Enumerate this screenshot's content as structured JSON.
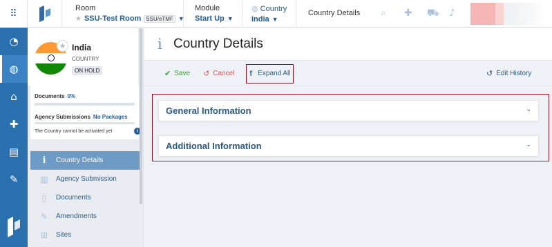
{
  "rail": {
    "grid_icon": "⠿",
    "items": [
      {
        "name": "dashboard-icon",
        "glyph": "◔"
      },
      {
        "name": "globe-icon",
        "glyph": "◍"
      },
      {
        "name": "institution-icon",
        "glyph": "⌂"
      },
      {
        "name": "medical-kit-icon",
        "glyph": "✚"
      },
      {
        "name": "document-icon",
        "glyph": "▤"
      },
      {
        "name": "edit-document-icon",
        "glyph": "✎"
      }
    ]
  },
  "topbar": {
    "room_caption": "Room",
    "room_value": "SSU-Test Room",
    "room_tag": "SSU/eTMF",
    "module_caption": "Module",
    "module_value": "Start Up",
    "country_caption": "Country",
    "country_value": "India",
    "current_page": "Country Details",
    "icons": [
      "search-icon",
      "plus-icon",
      "cart-icon",
      "bell-icon"
    ]
  },
  "profile": {
    "name": "India",
    "type": "COUNTRY",
    "status": "ON HOLD"
  },
  "stats": {
    "documents_label": "Documents",
    "documents_value": "0%",
    "agency_label": "Agency Submissions",
    "agency_value": "No Packages",
    "note": "The Country cannot be activated yet"
  },
  "nav": [
    {
      "label": "Country Details",
      "icon": "info-icon",
      "active": true
    },
    {
      "label": "Agency Submission",
      "icon": "building-icon",
      "active": false
    },
    {
      "label": "Documents",
      "icon": "file-icon",
      "active": false
    },
    {
      "label": "Amendments",
      "icon": "file-edit-icon",
      "active": false
    },
    {
      "label": "Sites",
      "icon": "hospital-icon",
      "active": false
    }
  ],
  "main": {
    "title": "Country Details",
    "toolbar": {
      "save": "Save",
      "cancel": "Cancel",
      "expand_all": "Expand All",
      "edit_history": "Edit History"
    },
    "sections": [
      {
        "label": "General Information"
      },
      {
        "label": "Additional Information"
      }
    ]
  },
  "colors": {
    "brand": "#2a6fae",
    "highlight": "#a40e1c",
    "save": "#3b9b3b",
    "cancel": "#d9534f"
  }
}
